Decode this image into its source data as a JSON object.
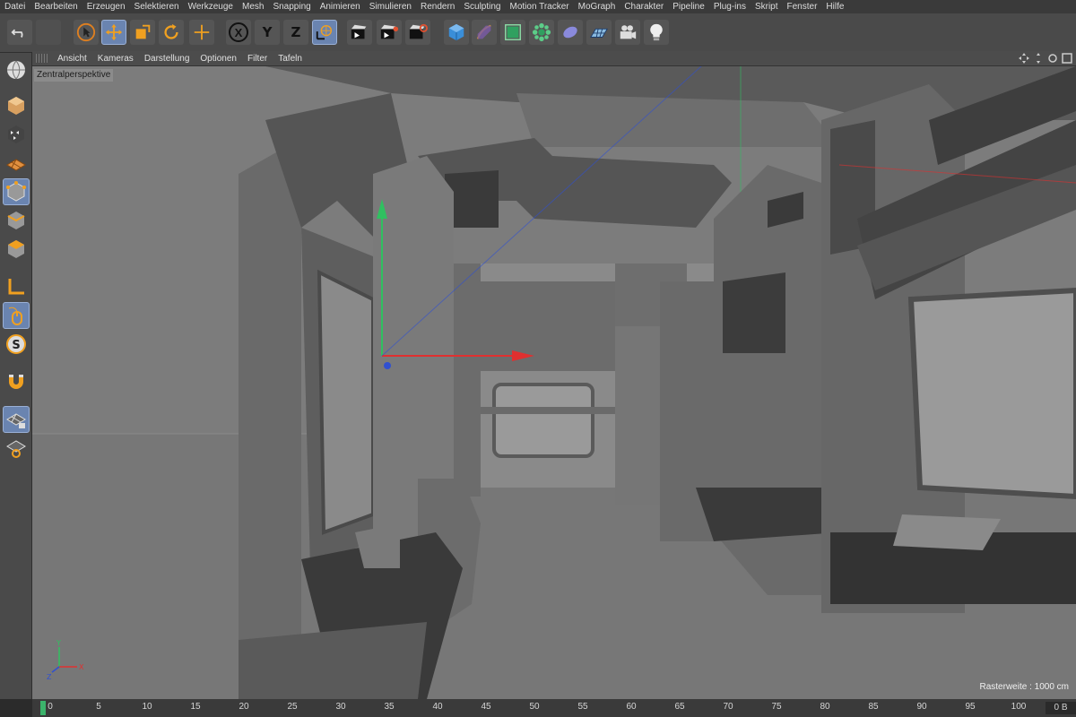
{
  "menu": [
    "Datei",
    "Bearbeiten",
    "Erzeugen",
    "Selektieren",
    "Werkzeuge",
    "Mesh",
    "Snapping",
    "Animieren",
    "Simulieren",
    "Rendern",
    "Sculpting",
    "Motion Tracker",
    "MoGraph",
    "Charakter",
    "Pipeline",
    "Plug-ins",
    "Skript",
    "Fenster",
    "Hilfe"
  ],
  "toolbar": {
    "axis_x": "X",
    "axis_y": "Y",
    "axis_z": "Z",
    "icons": [
      "undo-icon",
      "redo-icon",
      "select-icon",
      "move-icon",
      "scale-icon",
      "rotate-icon",
      "recent-tool-icon",
      "x-axis-icon",
      "y-axis-icon",
      "z-axis-icon",
      "coord-system-icon",
      "render-view-icon",
      "render-picture-icon",
      "render-settings-icon",
      "cube-icon",
      "pen-icon",
      "subdivision-icon",
      "array-icon",
      "deformer-icon",
      "floor-icon",
      "camera-icon",
      "light-icon"
    ]
  },
  "viewport": {
    "menu": [
      "Ansicht",
      "Kameras",
      "Darstellung",
      "Optionen",
      "Filter",
      "Tafeln"
    ],
    "label": "Zentralperspektive",
    "raster": "Rasterweite : 1000 cm",
    "axis_labels": {
      "x": "X",
      "y": "Y",
      "z": "Z"
    }
  },
  "colors": {
    "accent": "#6a84b0",
    "timeline_cursor": "#3bb36b",
    "axis_x": "#e03030",
    "axis_y": "#30c060",
    "axis_z": "#3050d0"
  },
  "timeline": {
    "ticks": [
      "0",
      "5",
      "10",
      "15",
      "20",
      "25",
      "30",
      "35",
      "40",
      "45",
      "50",
      "55",
      "60",
      "65",
      "70",
      "75",
      "80",
      "85",
      "90",
      "95",
      "100"
    ],
    "end_label": "0 B"
  }
}
